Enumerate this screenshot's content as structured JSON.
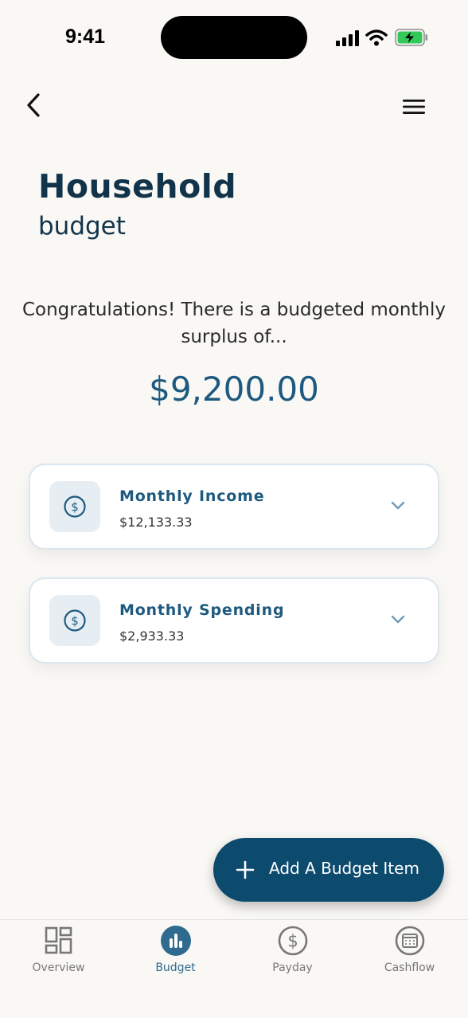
{
  "status_bar": {
    "time": "9:41"
  },
  "header": {
    "back_icon": "chevron-left-icon",
    "menu_icon": "hamburger-menu-icon"
  },
  "page": {
    "title": "Household",
    "subtitle": "budget",
    "message": "Congratulations! There is a budgeted monthly surplus of...",
    "surplus_amount": "$9,200.00"
  },
  "cards": [
    {
      "title": "Monthly Income",
      "value": "$12,133.33",
      "icon": "dollar-circle-icon"
    },
    {
      "title": "Monthly Spending",
      "value": "$2,933.33",
      "icon": "dollar-circle-icon"
    }
  ],
  "add_button": {
    "label": "Add A Budget Item",
    "icon": "plus-icon"
  },
  "bottom_nav": {
    "items": [
      {
        "label": "Overview",
        "icon": "grid-icon",
        "active": false
      },
      {
        "label": "Budget",
        "icon": "bar-chart-icon",
        "active": true
      },
      {
        "label": "Payday",
        "icon": "dollar-circle-icon",
        "active": false
      },
      {
        "label": "Cashflow",
        "icon": "calendar-icon",
        "active": false
      }
    ]
  },
  "colors": {
    "background": "#f9f8f5",
    "primary": "#0c4a6e",
    "accent": "#1e5a7f",
    "active_nav": "#2f6b8f",
    "battery": "#34c759"
  }
}
